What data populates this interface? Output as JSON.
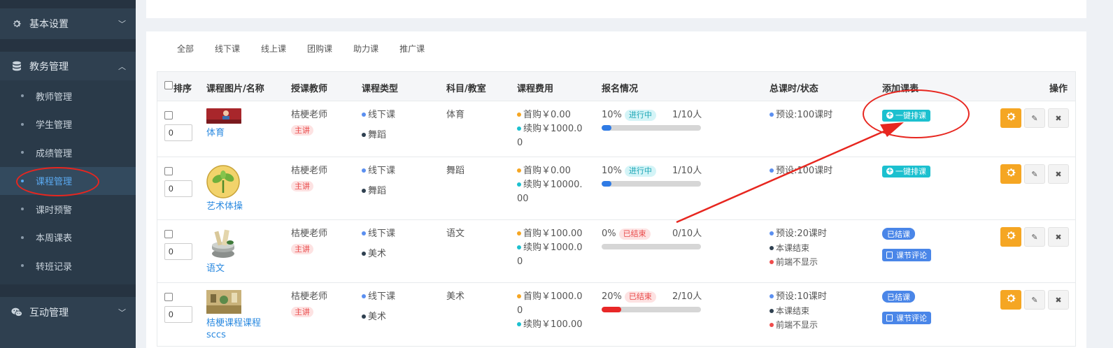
{
  "sidebar": {
    "groups": [
      {
        "label": "基本设置",
        "icon": "gear-icon"
      },
      {
        "label": "教务管理",
        "icon": "database-icon"
      },
      {
        "label": "互动管理",
        "icon": "wechat-icon"
      }
    ],
    "items": [
      {
        "label": "教师管理"
      },
      {
        "label": "学生管理"
      },
      {
        "label": "成绩管理"
      },
      {
        "label": "课程管理"
      },
      {
        "label": "课时预警"
      },
      {
        "label": "本周课表"
      },
      {
        "label": "转班记录"
      }
    ]
  },
  "tabs": [
    "全部",
    "线下课",
    "线上课",
    "团购课",
    "助力课",
    "推广课"
  ],
  "table": {
    "headers": {
      "sort": "排序",
      "name": "课程图片/名称",
      "teacher": "授课教师",
      "type": "课程类型",
      "subject": "科目/教室",
      "fee": "课程费用",
      "signup": "报名情况",
      "hours": "总课时/状态",
      "schedule": "添加课表",
      "ops": "操作"
    },
    "rows": [
      {
        "sort": "0",
        "name": "体育",
        "teacher": "桔梗老师",
        "role": "主讲",
        "mode": "线下课",
        "category": "舞蹈",
        "subject": "体育",
        "fee1": "首购￥0.00",
        "fee2a": "续购￥1000.0",
        "fee2b": "0",
        "percent": "10%",
        "status": "进行中",
        "count": "1/10人",
        "progress": 0.1,
        "hours": "预设:100课时",
        "schedule_btn": "一键排课"
      },
      {
        "sort": "0",
        "name": "艺术体操",
        "teacher": "桔梗老师",
        "role": "主讲",
        "mode": "线下课",
        "category": "舞蹈",
        "subject": "舞蹈",
        "fee1": "首购￥0.00",
        "fee2a": "续购￥10000.",
        "fee2b": "00",
        "percent": "10%",
        "status": "进行中",
        "count": "1/10人",
        "progress": 0.1,
        "hours": "预设:100课时",
        "schedule_btn": "一键排课"
      },
      {
        "sort": "0",
        "name": "语文",
        "teacher": "桔梗老师",
        "role": "主讲",
        "mode": "线下课",
        "category": "美术",
        "subject": "语文",
        "fee1": "首购￥100.00",
        "fee2a": "续购￥1000.0",
        "fee2b": "0",
        "percent": "0%",
        "status": "已结束",
        "count": "0/10人",
        "progress": 0,
        "hours": "预设:20课时",
        "hours2": "本课结束",
        "hours3": "前端不显示",
        "schedule_btn": "已结课",
        "review_btn": "课节评论"
      },
      {
        "sort": "0",
        "name": "桔梗课程课程",
        "name2": "sccs",
        "teacher": "桔梗老师",
        "role": "主讲",
        "mode": "线下课",
        "category": "美术",
        "subject": "美术",
        "fee1a": "首购￥1000.0",
        "fee1b": "0",
        "fee2": "续购￥100.00",
        "percent": "20%",
        "status": "已结束",
        "count": "2/10人",
        "progress": 0.2,
        "hours": "预设:10课时",
        "hours2": "本课结束",
        "hours3": "前端不显示",
        "schedule_btn": "已结课",
        "review_btn": "课节评论"
      }
    ]
  },
  "colors": {
    "sidebar_bg": "#2f4050",
    "active_link": "#5aa9f0",
    "teal": "#1cc0cf",
    "orange": "#f5a623",
    "annotation_red": "#e7261f"
  }
}
